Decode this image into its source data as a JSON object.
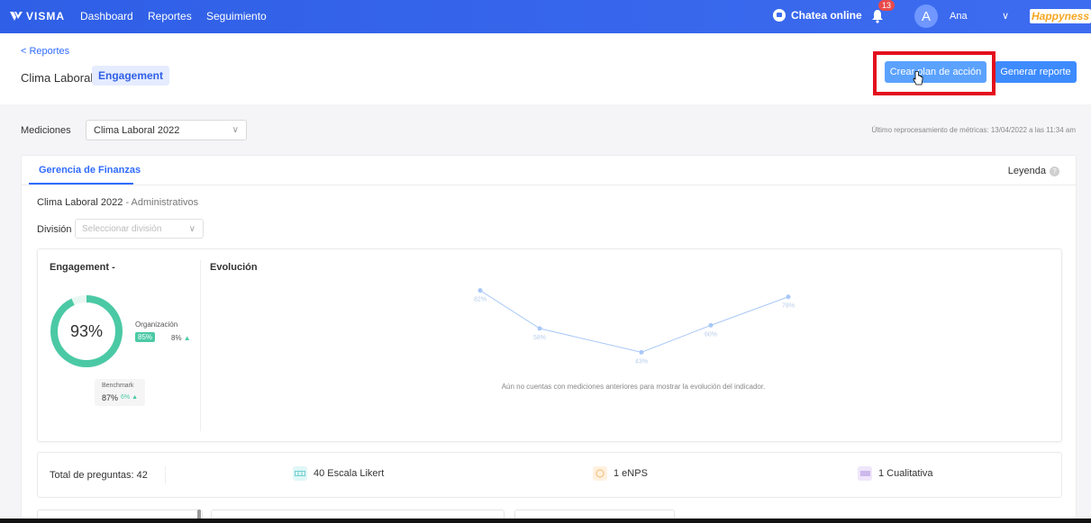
{
  "nav": {
    "brand": "VISMA",
    "links": [
      "Dashboard",
      "Reportes",
      "Seguimiento"
    ],
    "chat_label": "Chatea online",
    "notif_count": "13",
    "avatar_initial": "A",
    "user_name": "Ana",
    "partner_logo": "Happyness",
    "icons": {
      "chat": "chat-icon",
      "bell": "bell-icon",
      "chevron": "chevron-down-icon"
    }
  },
  "header": {
    "back_link": "< Reportes",
    "title": "Clima Laboral",
    "tag": "Engagement",
    "btn_plan": "Crear plan de acción",
    "btn_generate": "Generar reporte"
  },
  "measure": {
    "label": "Mediciones",
    "selected": "Clima Laboral 2022",
    "reprocess": "Último reprocesamiento de métricas: 13/04/2022 a las 11:34 am"
  },
  "card": {
    "tab": "Gerencia de Finanzas",
    "legend": "Leyenda",
    "subtitle_main": "Clima Laboral 2022",
    "subtitle_sec": " - Administrativos",
    "division_label": "División",
    "division_placeholder": "Seleccionar división"
  },
  "engagement": {
    "title": "Engagement -",
    "value_pct": 93,
    "value_label": "93%",
    "org_label": "Organización",
    "org_value": "85%",
    "org_diff": "8%",
    "bench_label": "Benchmark",
    "bench_value": "87%",
    "bench_diff": "6%",
    "colors": {
      "ring": "#4bc9a5",
      "track": "#e8f7f2"
    }
  },
  "evolution": {
    "title": "Evolución",
    "empty_msg": "Aún no cuentas con mediciones anteriores para mostrar la evolución del indicador."
  },
  "chart_data": {
    "type": "line",
    "x": [
      1,
      2,
      3,
      4,
      5
    ],
    "values": [
      82,
      58,
      43,
      60,
      78
    ],
    "labels": [
      "82%",
      "58%",
      "43%",
      "60%",
      "78%"
    ],
    "color": "#a9c8f7"
  },
  "questions": {
    "total": "Total de preguntas: 42",
    "likert": "40 Escala Likert",
    "enps": "1 eNPS",
    "qual": "1 Cualitativa"
  }
}
